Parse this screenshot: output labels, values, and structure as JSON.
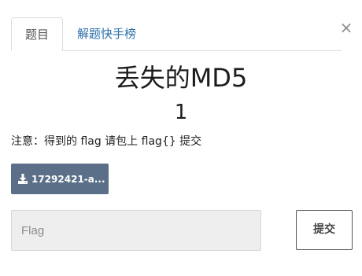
{
  "tabs": [
    {
      "label": "题目",
      "active": true
    },
    {
      "label": "解题快手榜",
      "active": false
    }
  ],
  "close_glyph": "×",
  "challenge": {
    "title": "丢失的MD5",
    "points": "1",
    "description": "注意：得到的 flag 请包上 flag{} 提交"
  },
  "download": {
    "icon": "download-icon",
    "label": "17292421-a..."
  },
  "flag_input": {
    "placeholder": "Flag",
    "value": ""
  },
  "submit_label": "提交",
  "colors": {
    "tab_link": "#2a6fa8",
    "download_bg": "#5b7088",
    "input_bg": "#eeeeee"
  }
}
